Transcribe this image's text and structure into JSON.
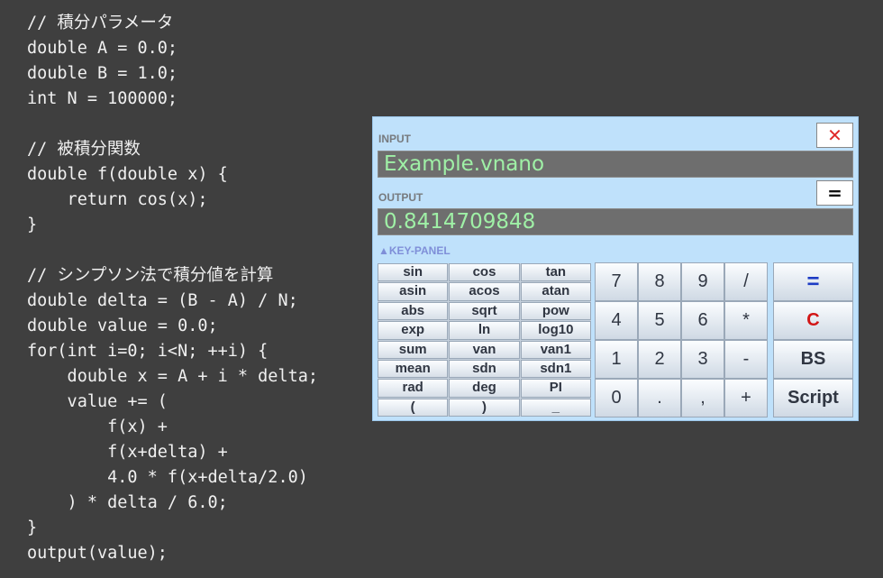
{
  "code_lines": [
    "// 積分パラメータ",
    "double A = 0.0;",
    "double B = 1.0;",
    "int N = 100000;",
    "",
    "// 被積分関数",
    "double f(double x) {",
    "    return cos(x);",
    "}",
    "",
    "// シンプソン法で積分値を計算",
    "double delta = (B - A) / N;",
    "double value = 0.0;",
    "for(int i=0; i<N; ++i) {",
    "    double x = A + i * delta;",
    "    value += (",
    "        f(x) +",
    "        f(x+delta) +",
    "        4.0 * f(x+delta/2.0)",
    "    ) * delta / 6.0;",
    "}",
    "output(value);"
  ],
  "calculator": {
    "input_label": "INPUT",
    "input_value": "Example.vnano",
    "output_label": "OUTPUT",
    "output_value": "0.8414709848",
    "close_label": "✕",
    "eq_label": "=",
    "keypanel_label": "▲KEY-PANEL",
    "function_keys": [
      "sin",
      "cos",
      "tan",
      "asin",
      "acos",
      "atan",
      "abs",
      "sqrt",
      "pow",
      "exp",
      "ln",
      "log10",
      "sum",
      "van",
      "van1",
      "mean",
      "sdn",
      "sdn1",
      "rad",
      "deg",
      "PI",
      "(",
      ")",
      "_"
    ],
    "number_keys": [
      "7",
      "8",
      "9",
      "/",
      "4",
      "5",
      "6",
      "*",
      "1",
      "2",
      "3",
      "-",
      "0",
      ".",
      ",",
      "+"
    ],
    "action_keys": [
      "=",
      "C",
      "BS",
      "Script"
    ]
  },
  "colors": {
    "background": "#3f3f3f",
    "panel": "#bfe1fb",
    "field_text": "#9ff0a6",
    "clear": "#d21515",
    "equals": "#1d3cc4"
  }
}
